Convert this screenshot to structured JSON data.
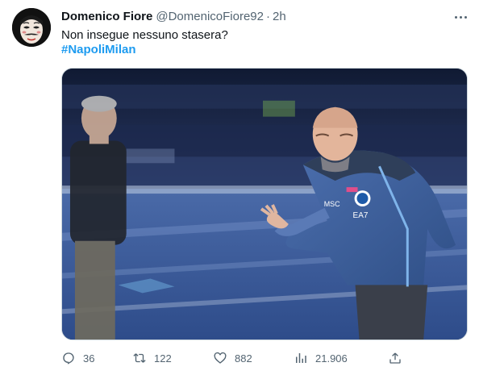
{
  "tweet": {
    "author_name": "Domenico Fiore",
    "handle": "@DomenicoFiore92",
    "separator": "·",
    "time": "2h",
    "text": "Non insegue nessuno stasera?",
    "hashtag": "#NapoliMilan"
  },
  "media": {
    "jersey_text_left": "MSC",
    "jersey_text_right": "EA7"
  },
  "actions": {
    "replies": "36",
    "retweets": "122",
    "likes": "882",
    "views": "21.906"
  },
  "colors": {
    "link": "#1d9bf0",
    "secondary_text": "#536471",
    "primary_text": "#0f1419"
  },
  "icons": {
    "avatar": "masked-face-avatar",
    "more": "more-options-icon",
    "reply": "reply-icon",
    "retweet": "retweet-icon",
    "like": "like-icon",
    "views": "views-icon",
    "share": "share-icon"
  }
}
